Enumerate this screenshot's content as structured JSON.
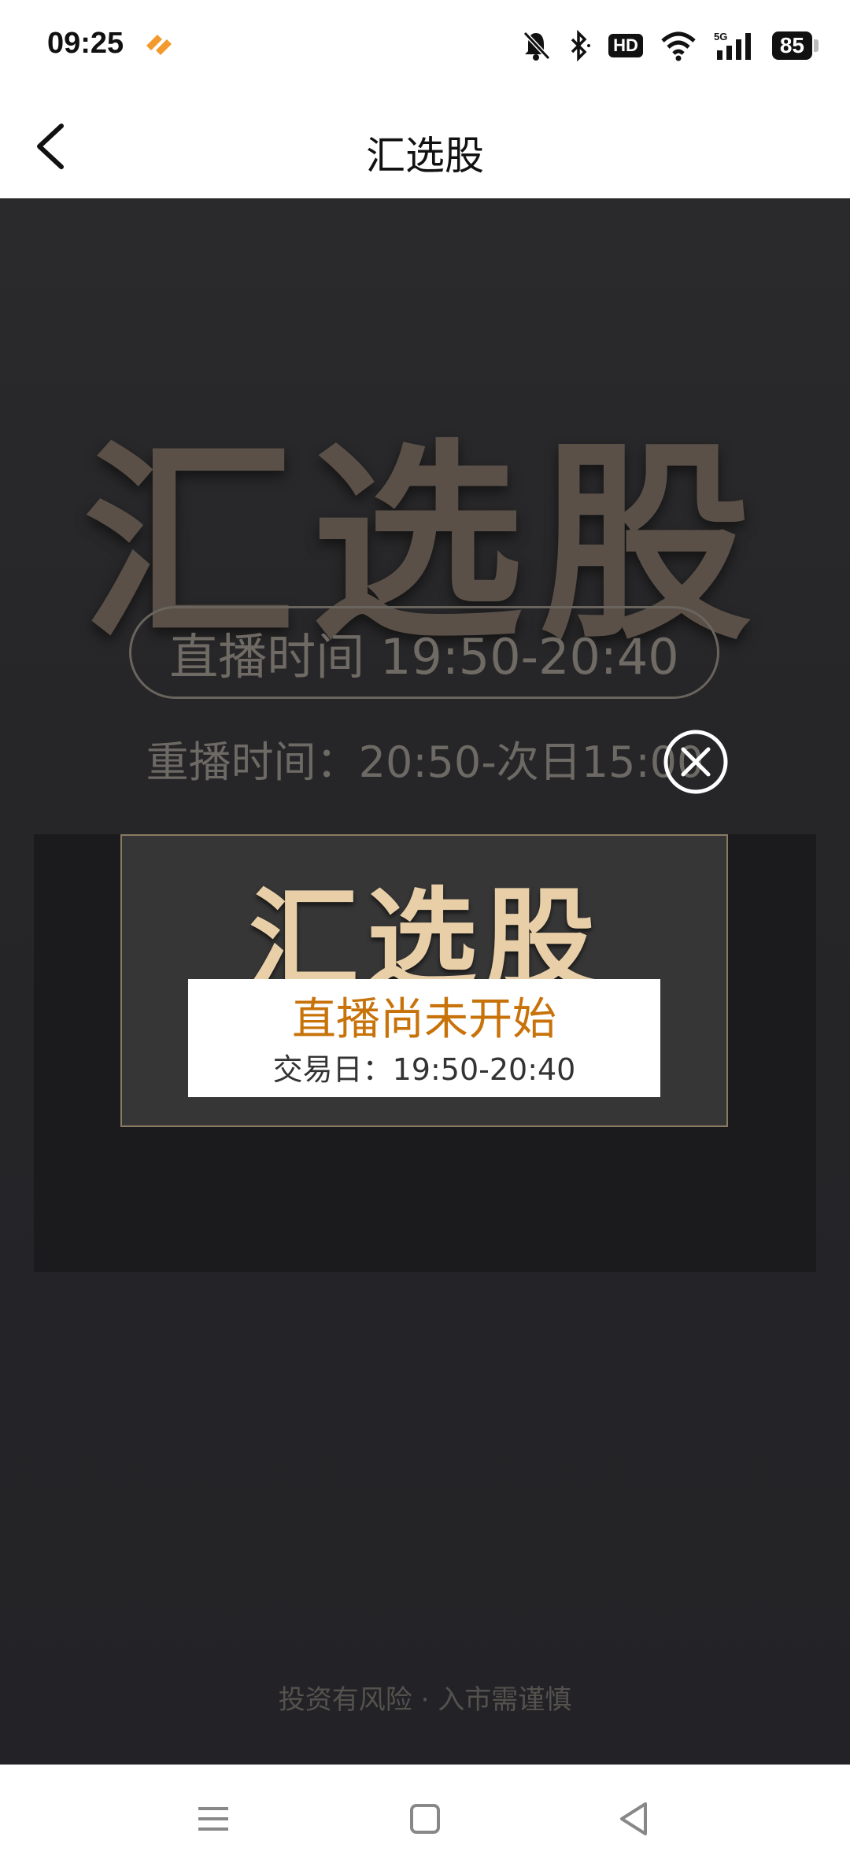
{
  "status": {
    "time": "09:25",
    "hd_label": "HD",
    "network_label": "5G",
    "battery": "85"
  },
  "nav": {
    "title": "汇选股"
  },
  "hero": {
    "title": "汇选股",
    "live_time": "直播时间 19:50-20:40",
    "replay_time": "重播时间：20:50-次日15:00"
  },
  "player": {
    "banner_title": "汇选股",
    "notice_title": "直播尚未开始",
    "notice_time": "交易日：19:50-20:40"
  },
  "footer": {
    "disclaimer": "投资有风险 · 入市需谨慎"
  },
  "colors": {
    "accent": "#c8720a",
    "background": "#262628",
    "gold": "#e8cfa8"
  },
  "icons": [
    "back-arrow-icon",
    "mute-bell-icon",
    "bluetooth-icon",
    "wifi-icon",
    "signal-icon",
    "close-icon",
    "menu-icon",
    "home-icon",
    "back-triangle-icon"
  ]
}
